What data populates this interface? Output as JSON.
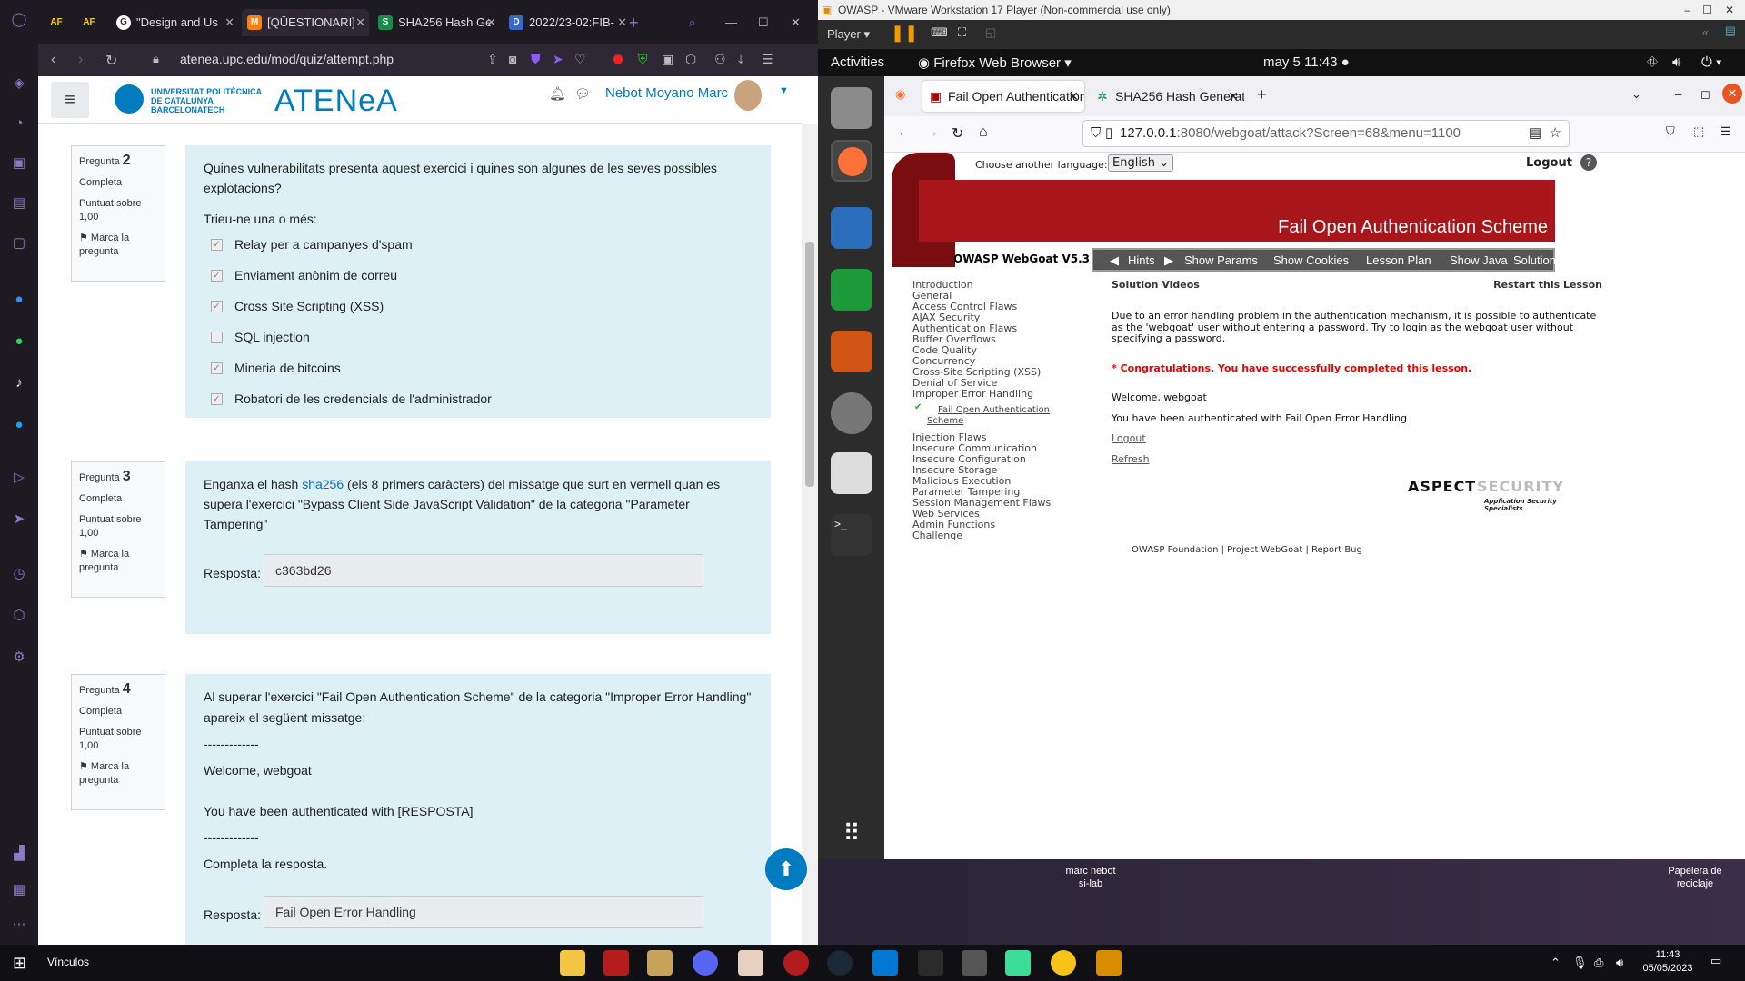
{
  "opera": {
    "tabs": [
      {
        "label": "",
        "fav": "AF"
      },
      {
        "label": "",
        "fav": "AF"
      },
      {
        "label": "\"Design and Us",
        "fav": "G"
      },
      {
        "label": "[QÜESTIONARI]",
        "fav": "M"
      },
      {
        "label": "SHA256 Hash Ge",
        "fav": "S"
      },
      {
        "label": "2022/23-02:FIB-",
        "fav": "D"
      }
    ],
    "url": "atenea.upc.edu/mod/quiz/attempt.php"
  },
  "moodle": {
    "brand_line1": "UNIVERSITAT POLITÈCNICA",
    "brand_line2": "DE CATALUNYA",
    "brand_line3": "BARCELONATECH",
    "atenea": "ATENeA",
    "user": "Nebot Moyano Marc",
    "questions": [
      {
        "label": "Pregunta",
        "num": "2",
        "state": "Completa",
        "score": "Puntuat sobre 1,00",
        "flag": "Marca la pregunta",
        "text": "Quines vulnerabilitats presenta aquest exercici i quines son algunes de  les seves possibles explotacions?",
        "prompt": "Trieu-ne una o més:",
        "options": [
          {
            "label": "Relay per a campanyes d'spam",
            "checked": true
          },
          {
            "label": "Enviament anònim de correu",
            "checked": true
          },
          {
            "label": "Cross Site Scripting (XSS)",
            "checked": true
          },
          {
            "label": "SQL injection",
            "checked": false
          },
          {
            "label": "Mineria de bitcoins",
            "checked": true
          },
          {
            "label": "Robatori de les credencials de l'administrador",
            "checked": true
          }
        ]
      },
      {
        "label": "Pregunta",
        "num": "3",
        "state": "Completa",
        "score": "Puntuat sobre 1,00",
        "flag": "Marca la pregunta",
        "text_pre": "Enganxa el hash ",
        "text_link": "sha256",
        "text_post": " (els 8 primers caràcters) del missatge que surt en vermell quan es supera l'exercici \"Bypass Client Side JavaScript Validation\" de la categoria \"Parameter Tampering\"",
        "answer_label": "Resposta:",
        "answer": "c363bd26"
      },
      {
        "label": "Pregunta",
        "num": "4",
        "state": "Completa",
        "score": "Puntuat sobre 1,00",
        "flag": "Marca la pregunta",
        "text": "Al superar l'exercici \"Fail Open Authentication Scheme\" de la categoria \"Improper Error Handling\" apareix el següent missatge:",
        "sep": "-------------",
        "line1": "Welcome, webgoat",
        "line2": "You have been authenticated with  [RESPOSTA]",
        "sep2": "-------------",
        "instr": "Completa la resposta.",
        "answer_label": "Resposta:",
        "answer": "Fail Open Error Handling"
      }
    ]
  },
  "vmware": {
    "title": "OWASP - VMware Workstation 17 Player (Non-commercial use only)",
    "player": "Player",
    "gnome": {
      "activities": "Activities",
      "app": "Firefox Web Browser",
      "clock": "may 5  11:43"
    },
    "ff_tabs": [
      "Fail Open Authentication",
      "SHA256 Hash Generator"
    ],
    "url_host": "127.0.0.1",
    "url_rest": ":8080/webgoat/attack?Screen=68&menu=1100",
    "desktop_user": "marc nebot",
    "desktop_host": "si-lab",
    "recycle": "Papelera de reciclaje"
  },
  "webgoat": {
    "lang_label": "Choose another language:",
    "lang": "English",
    "logout": "Logout",
    "banner_title": "Fail Open Authentication Scheme",
    "version": "OWASP WebGoat V5.3",
    "menu": [
      "Hints",
      "Show Params",
      "Show Cookies",
      "Lesson Plan",
      "Show Java",
      "Solution"
    ],
    "categories_before": [
      "Introduction",
      "General",
      "Access Control Flaws",
      "AJAX Security",
      "Authentication Flaws",
      "Buffer Overflows",
      "Code Quality",
      "Concurrency",
      "Cross-Site Scripting (XSS)",
      "Denial of Service",
      "Improper Error Handling"
    ],
    "current_lesson": "Fail Open Authentication Scheme",
    "categories_after": [
      "Injection Flaws",
      "Insecure Communication",
      "Insecure Configuration",
      "Insecure Storage",
      "Malicious Execution",
      "Parameter Tampering",
      "Session Management Flaws",
      "Web Services",
      "Admin Functions",
      "Challenge"
    ],
    "solution_videos": "Solution Videos",
    "restart": "Restart this Lesson",
    "description": "Due to an error handling problem in the authentication mechanism, it is possible to authenticate as the 'webgoat' user without entering a password. Try to login as the webgoat user without specifying a password.",
    "congrats": "* Congratulations. You have successfully completed this lesson.",
    "welcome": "Welcome, webgoat",
    "authenticated": "You have been authenticated with Fail Open Error Handling",
    "logout_link": "Logout",
    "refresh_link": "Refresh",
    "aspect1": "ASPECT",
    "aspect2": "SECURITY",
    "aspect_tag": "Application Security Specialists",
    "footer": "OWASP Foundation | Project WebGoat | Report Bug"
  },
  "taskbar": {
    "vinculos": "Vínculos",
    "time": "11:43",
    "date": "05/05/2023"
  }
}
